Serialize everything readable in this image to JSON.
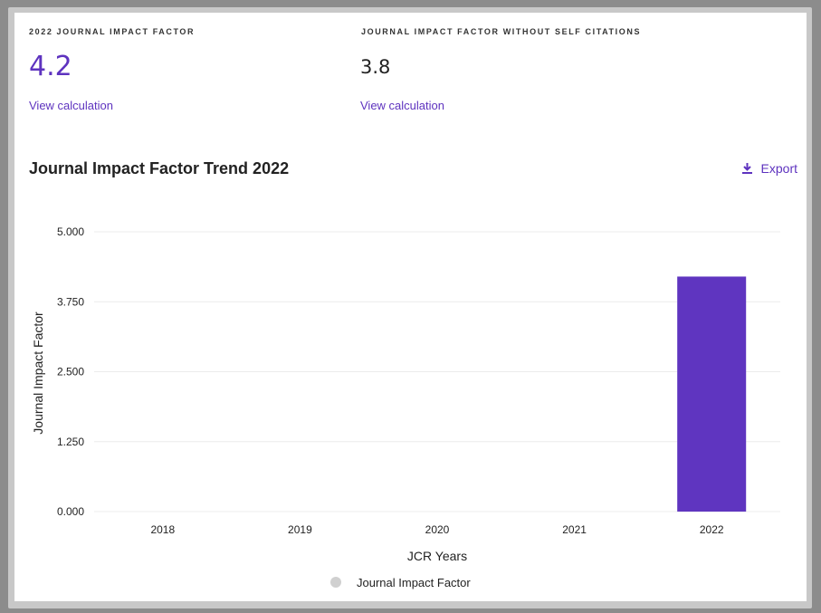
{
  "metrics": {
    "jif_label": "2022 JOURNAL IMPACT FACTOR",
    "jif_value": "4.2",
    "jif_link": "View calculation",
    "jif_no_self_label": "JOURNAL IMPACT FACTOR WITHOUT SELF CITATIONS",
    "jif_no_self_value": "3.8",
    "jif_no_self_link": "View calculation"
  },
  "chart_header": {
    "title": "Journal Impact Factor Trend 2022",
    "export_label": "Export",
    "export_icon": "download-icon"
  },
  "colors": {
    "accent": "#5e33bf",
    "bar": "#5f35c0",
    "legend_marker": "#d0d0d0"
  },
  "chart_data": {
    "type": "bar",
    "categories": [
      "2018",
      "2019",
      "2020",
      "2021",
      "2022"
    ],
    "series": [
      {
        "name": "Journal Impact Factor",
        "values": [
          null,
          null,
          null,
          null,
          4.2
        ]
      }
    ],
    "ylim": [
      0,
      5
    ],
    "yticks": [
      "0.000",
      "1.250",
      "2.500",
      "3.750",
      "5.000"
    ],
    "ytick_values": [
      0,
      1.25,
      2.5,
      3.75,
      5
    ],
    "xlabel": "JCR Years",
    "ylabel": "Journal Impact Factor",
    "grid": true,
    "legend_position": "bottom"
  }
}
